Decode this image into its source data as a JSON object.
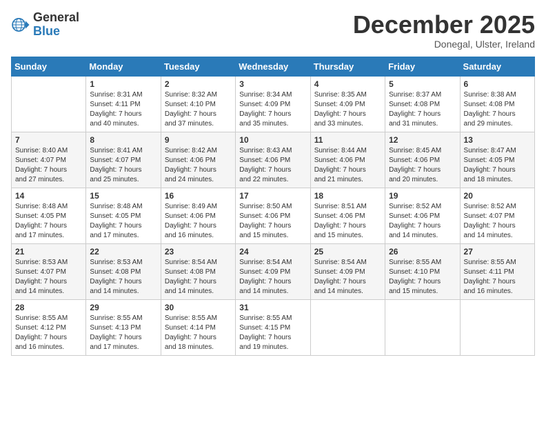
{
  "header": {
    "logo_general": "General",
    "logo_blue": "Blue",
    "month_title": "December 2025",
    "subtitle": "Donegal, Ulster, Ireland"
  },
  "days_of_week": [
    "Sunday",
    "Monday",
    "Tuesday",
    "Wednesday",
    "Thursday",
    "Friday",
    "Saturday"
  ],
  "weeks": [
    [
      {
        "day": "",
        "info": ""
      },
      {
        "day": "1",
        "info": "Sunrise: 8:31 AM\nSunset: 4:11 PM\nDaylight: 7 hours\nand 40 minutes."
      },
      {
        "day": "2",
        "info": "Sunrise: 8:32 AM\nSunset: 4:10 PM\nDaylight: 7 hours\nand 37 minutes."
      },
      {
        "day": "3",
        "info": "Sunrise: 8:34 AM\nSunset: 4:09 PM\nDaylight: 7 hours\nand 35 minutes."
      },
      {
        "day": "4",
        "info": "Sunrise: 8:35 AM\nSunset: 4:09 PM\nDaylight: 7 hours\nand 33 minutes."
      },
      {
        "day": "5",
        "info": "Sunrise: 8:37 AM\nSunset: 4:08 PM\nDaylight: 7 hours\nand 31 minutes."
      },
      {
        "day": "6",
        "info": "Sunrise: 8:38 AM\nSunset: 4:08 PM\nDaylight: 7 hours\nand 29 minutes."
      }
    ],
    [
      {
        "day": "7",
        "info": "Sunrise: 8:40 AM\nSunset: 4:07 PM\nDaylight: 7 hours\nand 27 minutes."
      },
      {
        "day": "8",
        "info": "Sunrise: 8:41 AM\nSunset: 4:07 PM\nDaylight: 7 hours\nand 25 minutes."
      },
      {
        "day": "9",
        "info": "Sunrise: 8:42 AM\nSunset: 4:06 PM\nDaylight: 7 hours\nand 24 minutes."
      },
      {
        "day": "10",
        "info": "Sunrise: 8:43 AM\nSunset: 4:06 PM\nDaylight: 7 hours\nand 22 minutes."
      },
      {
        "day": "11",
        "info": "Sunrise: 8:44 AM\nSunset: 4:06 PM\nDaylight: 7 hours\nand 21 minutes."
      },
      {
        "day": "12",
        "info": "Sunrise: 8:45 AM\nSunset: 4:06 PM\nDaylight: 7 hours\nand 20 minutes."
      },
      {
        "day": "13",
        "info": "Sunrise: 8:47 AM\nSunset: 4:05 PM\nDaylight: 7 hours\nand 18 minutes."
      }
    ],
    [
      {
        "day": "14",
        "info": "Sunrise: 8:48 AM\nSunset: 4:05 PM\nDaylight: 7 hours\nand 17 minutes."
      },
      {
        "day": "15",
        "info": "Sunrise: 8:48 AM\nSunset: 4:05 PM\nDaylight: 7 hours\nand 17 minutes."
      },
      {
        "day": "16",
        "info": "Sunrise: 8:49 AM\nSunset: 4:06 PM\nDaylight: 7 hours\nand 16 minutes."
      },
      {
        "day": "17",
        "info": "Sunrise: 8:50 AM\nSunset: 4:06 PM\nDaylight: 7 hours\nand 15 minutes."
      },
      {
        "day": "18",
        "info": "Sunrise: 8:51 AM\nSunset: 4:06 PM\nDaylight: 7 hours\nand 15 minutes."
      },
      {
        "day": "19",
        "info": "Sunrise: 8:52 AM\nSunset: 4:06 PM\nDaylight: 7 hours\nand 14 minutes."
      },
      {
        "day": "20",
        "info": "Sunrise: 8:52 AM\nSunset: 4:07 PM\nDaylight: 7 hours\nand 14 minutes."
      }
    ],
    [
      {
        "day": "21",
        "info": "Sunrise: 8:53 AM\nSunset: 4:07 PM\nDaylight: 7 hours\nand 14 minutes."
      },
      {
        "day": "22",
        "info": "Sunrise: 8:53 AM\nSunset: 4:08 PM\nDaylight: 7 hours\nand 14 minutes."
      },
      {
        "day": "23",
        "info": "Sunrise: 8:54 AM\nSunset: 4:08 PM\nDaylight: 7 hours\nand 14 minutes."
      },
      {
        "day": "24",
        "info": "Sunrise: 8:54 AM\nSunset: 4:09 PM\nDaylight: 7 hours\nand 14 minutes."
      },
      {
        "day": "25",
        "info": "Sunrise: 8:54 AM\nSunset: 4:09 PM\nDaylight: 7 hours\nand 14 minutes."
      },
      {
        "day": "26",
        "info": "Sunrise: 8:55 AM\nSunset: 4:10 PM\nDaylight: 7 hours\nand 15 minutes."
      },
      {
        "day": "27",
        "info": "Sunrise: 8:55 AM\nSunset: 4:11 PM\nDaylight: 7 hours\nand 16 minutes."
      }
    ],
    [
      {
        "day": "28",
        "info": "Sunrise: 8:55 AM\nSunset: 4:12 PM\nDaylight: 7 hours\nand 16 minutes."
      },
      {
        "day": "29",
        "info": "Sunrise: 8:55 AM\nSunset: 4:13 PM\nDaylight: 7 hours\nand 17 minutes."
      },
      {
        "day": "30",
        "info": "Sunrise: 8:55 AM\nSunset: 4:14 PM\nDaylight: 7 hours\nand 18 minutes."
      },
      {
        "day": "31",
        "info": "Sunrise: 8:55 AM\nSunset: 4:15 PM\nDaylight: 7 hours\nand 19 minutes."
      },
      {
        "day": "",
        "info": ""
      },
      {
        "day": "",
        "info": ""
      },
      {
        "day": "",
        "info": ""
      }
    ]
  ]
}
